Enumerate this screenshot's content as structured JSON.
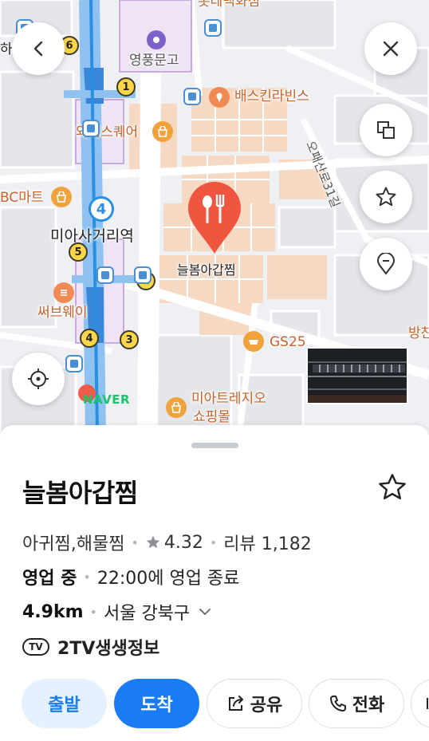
{
  "map": {
    "labels": {
      "top_cut": "롯데백화점",
      "left_cut": "하",
      "school": "영풍문고",
      "baskin": "배스킨라빈스",
      "ysquare": "와이스퀘어",
      "bbc": "BC마트",
      "station": "미아사거리역",
      "restaurant": "늘봄아갑찜",
      "subway": "써브웨이",
      "gs25": "GS25",
      "street": "오패산로31길",
      "mall_line1": "미아트레지오",
      "mall_line2": "쇼핑몰",
      "right_cut": "방찬",
      "naver": "NAVER",
      "line_number": "4"
    },
    "exits": [
      "6",
      "1",
      "2",
      "5",
      "4",
      "3"
    ]
  },
  "sheet": {
    "name": "늘봄아갑찜",
    "category": "아귀찜,해물찜",
    "rating": "4.32",
    "review_label": "리뷰 1,182",
    "status": "영업 중",
    "hours": "22:00에 영업 종료",
    "distance": "4.9km",
    "region": "서울 강북구",
    "tv_badge": "TV",
    "tv_show": "2TV생생정보"
  },
  "actions": {
    "start": "출발",
    "arrive": "도착",
    "share": "공유",
    "call": "전화"
  },
  "colors": {
    "accent": "#1a7cf2",
    "pin": "#f0553f",
    "subway_line": "#2a8fe0"
  }
}
